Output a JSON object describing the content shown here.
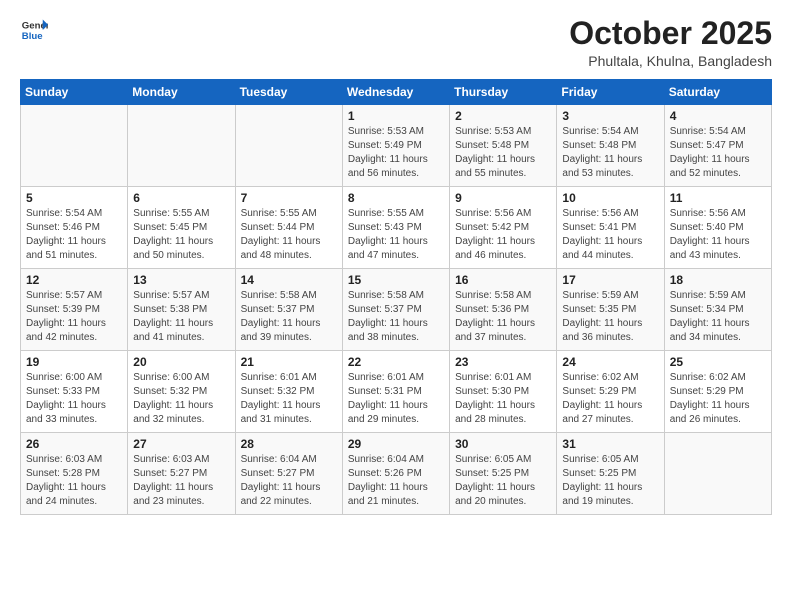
{
  "header": {
    "logo_line1": "General",
    "logo_line2": "Blue",
    "month": "October 2025",
    "location": "Phultala, Khulna, Bangladesh"
  },
  "weekdays": [
    "Sunday",
    "Monday",
    "Tuesday",
    "Wednesday",
    "Thursday",
    "Friday",
    "Saturday"
  ],
  "weeks": [
    [
      {
        "day": "",
        "info": ""
      },
      {
        "day": "",
        "info": ""
      },
      {
        "day": "",
        "info": ""
      },
      {
        "day": "1",
        "info": "Sunrise: 5:53 AM\nSunset: 5:49 PM\nDaylight: 11 hours and 56 minutes."
      },
      {
        "day": "2",
        "info": "Sunrise: 5:53 AM\nSunset: 5:48 PM\nDaylight: 11 hours and 55 minutes."
      },
      {
        "day": "3",
        "info": "Sunrise: 5:54 AM\nSunset: 5:48 PM\nDaylight: 11 hours and 53 minutes."
      },
      {
        "day": "4",
        "info": "Sunrise: 5:54 AM\nSunset: 5:47 PM\nDaylight: 11 hours and 52 minutes."
      }
    ],
    [
      {
        "day": "5",
        "info": "Sunrise: 5:54 AM\nSunset: 5:46 PM\nDaylight: 11 hours and 51 minutes."
      },
      {
        "day": "6",
        "info": "Sunrise: 5:55 AM\nSunset: 5:45 PM\nDaylight: 11 hours and 50 minutes."
      },
      {
        "day": "7",
        "info": "Sunrise: 5:55 AM\nSunset: 5:44 PM\nDaylight: 11 hours and 48 minutes."
      },
      {
        "day": "8",
        "info": "Sunrise: 5:55 AM\nSunset: 5:43 PM\nDaylight: 11 hours and 47 minutes."
      },
      {
        "day": "9",
        "info": "Sunrise: 5:56 AM\nSunset: 5:42 PM\nDaylight: 11 hours and 46 minutes."
      },
      {
        "day": "10",
        "info": "Sunrise: 5:56 AM\nSunset: 5:41 PM\nDaylight: 11 hours and 44 minutes."
      },
      {
        "day": "11",
        "info": "Sunrise: 5:56 AM\nSunset: 5:40 PM\nDaylight: 11 hours and 43 minutes."
      }
    ],
    [
      {
        "day": "12",
        "info": "Sunrise: 5:57 AM\nSunset: 5:39 PM\nDaylight: 11 hours and 42 minutes."
      },
      {
        "day": "13",
        "info": "Sunrise: 5:57 AM\nSunset: 5:38 PM\nDaylight: 11 hours and 41 minutes."
      },
      {
        "day": "14",
        "info": "Sunrise: 5:58 AM\nSunset: 5:37 PM\nDaylight: 11 hours and 39 minutes."
      },
      {
        "day": "15",
        "info": "Sunrise: 5:58 AM\nSunset: 5:37 PM\nDaylight: 11 hours and 38 minutes."
      },
      {
        "day": "16",
        "info": "Sunrise: 5:58 AM\nSunset: 5:36 PM\nDaylight: 11 hours and 37 minutes."
      },
      {
        "day": "17",
        "info": "Sunrise: 5:59 AM\nSunset: 5:35 PM\nDaylight: 11 hours and 36 minutes."
      },
      {
        "day": "18",
        "info": "Sunrise: 5:59 AM\nSunset: 5:34 PM\nDaylight: 11 hours and 34 minutes."
      }
    ],
    [
      {
        "day": "19",
        "info": "Sunrise: 6:00 AM\nSunset: 5:33 PM\nDaylight: 11 hours and 33 minutes."
      },
      {
        "day": "20",
        "info": "Sunrise: 6:00 AM\nSunset: 5:32 PM\nDaylight: 11 hours and 32 minutes."
      },
      {
        "day": "21",
        "info": "Sunrise: 6:01 AM\nSunset: 5:32 PM\nDaylight: 11 hours and 31 minutes."
      },
      {
        "day": "22",
        "info": "Sunrise: 6:01 AM\nSunset: 5:31 PM\nDaylight: 11 hours and 29 minutes."
      },
      {
        "day": "23",
        "info": "Sunrise: 6:01 AM\nSunset: 5:30 PM\nDaylight: 11 hours and 28 minutes."
      },
      {
        "day": "24",
        "info": "Sunrise: 6:02 AM\nSunset: 5:29 PM\nDaylight: 11 hours and 27 minutes."
      },
      {
        "day": "25",
        "info": "Sunrise: 6:02 AM\nSunset: 5:29 PM\nDaylight: 11 hours and 26 minutes."
      }
    ],
    [
      {
        "day": "26",
        "info": "Sunrise: 6:03 AM\nSunset: 5:28 PM\nDaylight: 11 hours and 24 minutes."
      },
      {
        "day": "27",
        "info": "Sunrise: 6:03 AM\nSunset: 5:27 PM\nDaylight: 11 hours and 23 minutes."
      },
      {
        "day": "28",
        "info": "Sunrise: 6:04 AM\nSunset: 5:27 PM\nDaylight: 11 hours and 22 minutes."
      },
      {
        "day": "29",
        "info": "Sunrise: 6:04 AM\nSunset: 5:26 PM\nDaylight: 11 hours and 21 minutes."
      },
      {
        "day": "30",
        "info": "Sunrise: 6:05 AM\nSunset: 5:25 PM\nDaylight: 11 hours and 20 minutes."
      },
      {
        "day": "31",
        "info": "Sunrise: 6:05 AM\nSunset: 5:25 PM\nDaylight: 11 hours and 19 minutes."
      },
      {
        "day": "",
        "info": ""
      }
    ]
  ]
}
